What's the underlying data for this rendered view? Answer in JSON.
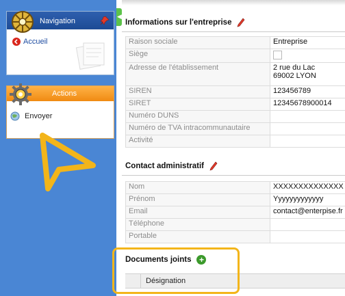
{
  "navigation": {
    "title": "Navigation",
    "items": [
      {
        "label": "Accueil"
      }
    ]
  },
  "actions": {
    "title": "Actions",
    "items": [
      {
        "label": "Envoyer"
      }
    ]
  },
  "entreprise": {
    "title": "Informations sur l'entreprise",
    "rows": [
      {
        "label": "Raison sociale",
        "value": "Entreprise"
      },
      {
        "label": "Siège",
        "value": ""
      },
      {
        "label": "Adresse de l'établissement",
        "value": "2 rue du Lac",
        "value2": "69002 LYON"
      },
      {
        "label": "SIREN",
        "value": "123456789"
      },
      {
        "label": "SIRET",
        "value": "12345678900014"
      },
      {
        "label": "Numéro DUNS",
        "value": ""
      },
      {
        "label": "Numéro de TVA intracommunautaire",
        "value": ""
      },
      {
        "label": "Activité",
        "value": ""
      }
    ]
  },
  "contact": {
    "title": "Contact administratif",
    "rows": [
      {
        "label": "Nom",
        "value": "XXXXXXXXXXXXXX"
      },
      {
        "label": "Prénom",
        "value": "Yyyyyyyyyyyyy"
      },
      {
        "label": "Email",
        "value": "contact@enterpise.fr"
      },
      {
        "label": "Téléphone",
        "value": ""
      },
      {
        "label": "Portable",
        "value": ""
      }
    ]
  },
  "documents": {
    "title": "Documents joints",
    "columns": [
      "Désignation"
    ]
  },
  "colors": {
    "sidebar": "#4a86d4",
    "nav_header": "#1d4b95",
    "actions_header": "#f08a12",
    "highlight": "#f3b51a",
    "add_green": "#3c9a2c"
  }
}
